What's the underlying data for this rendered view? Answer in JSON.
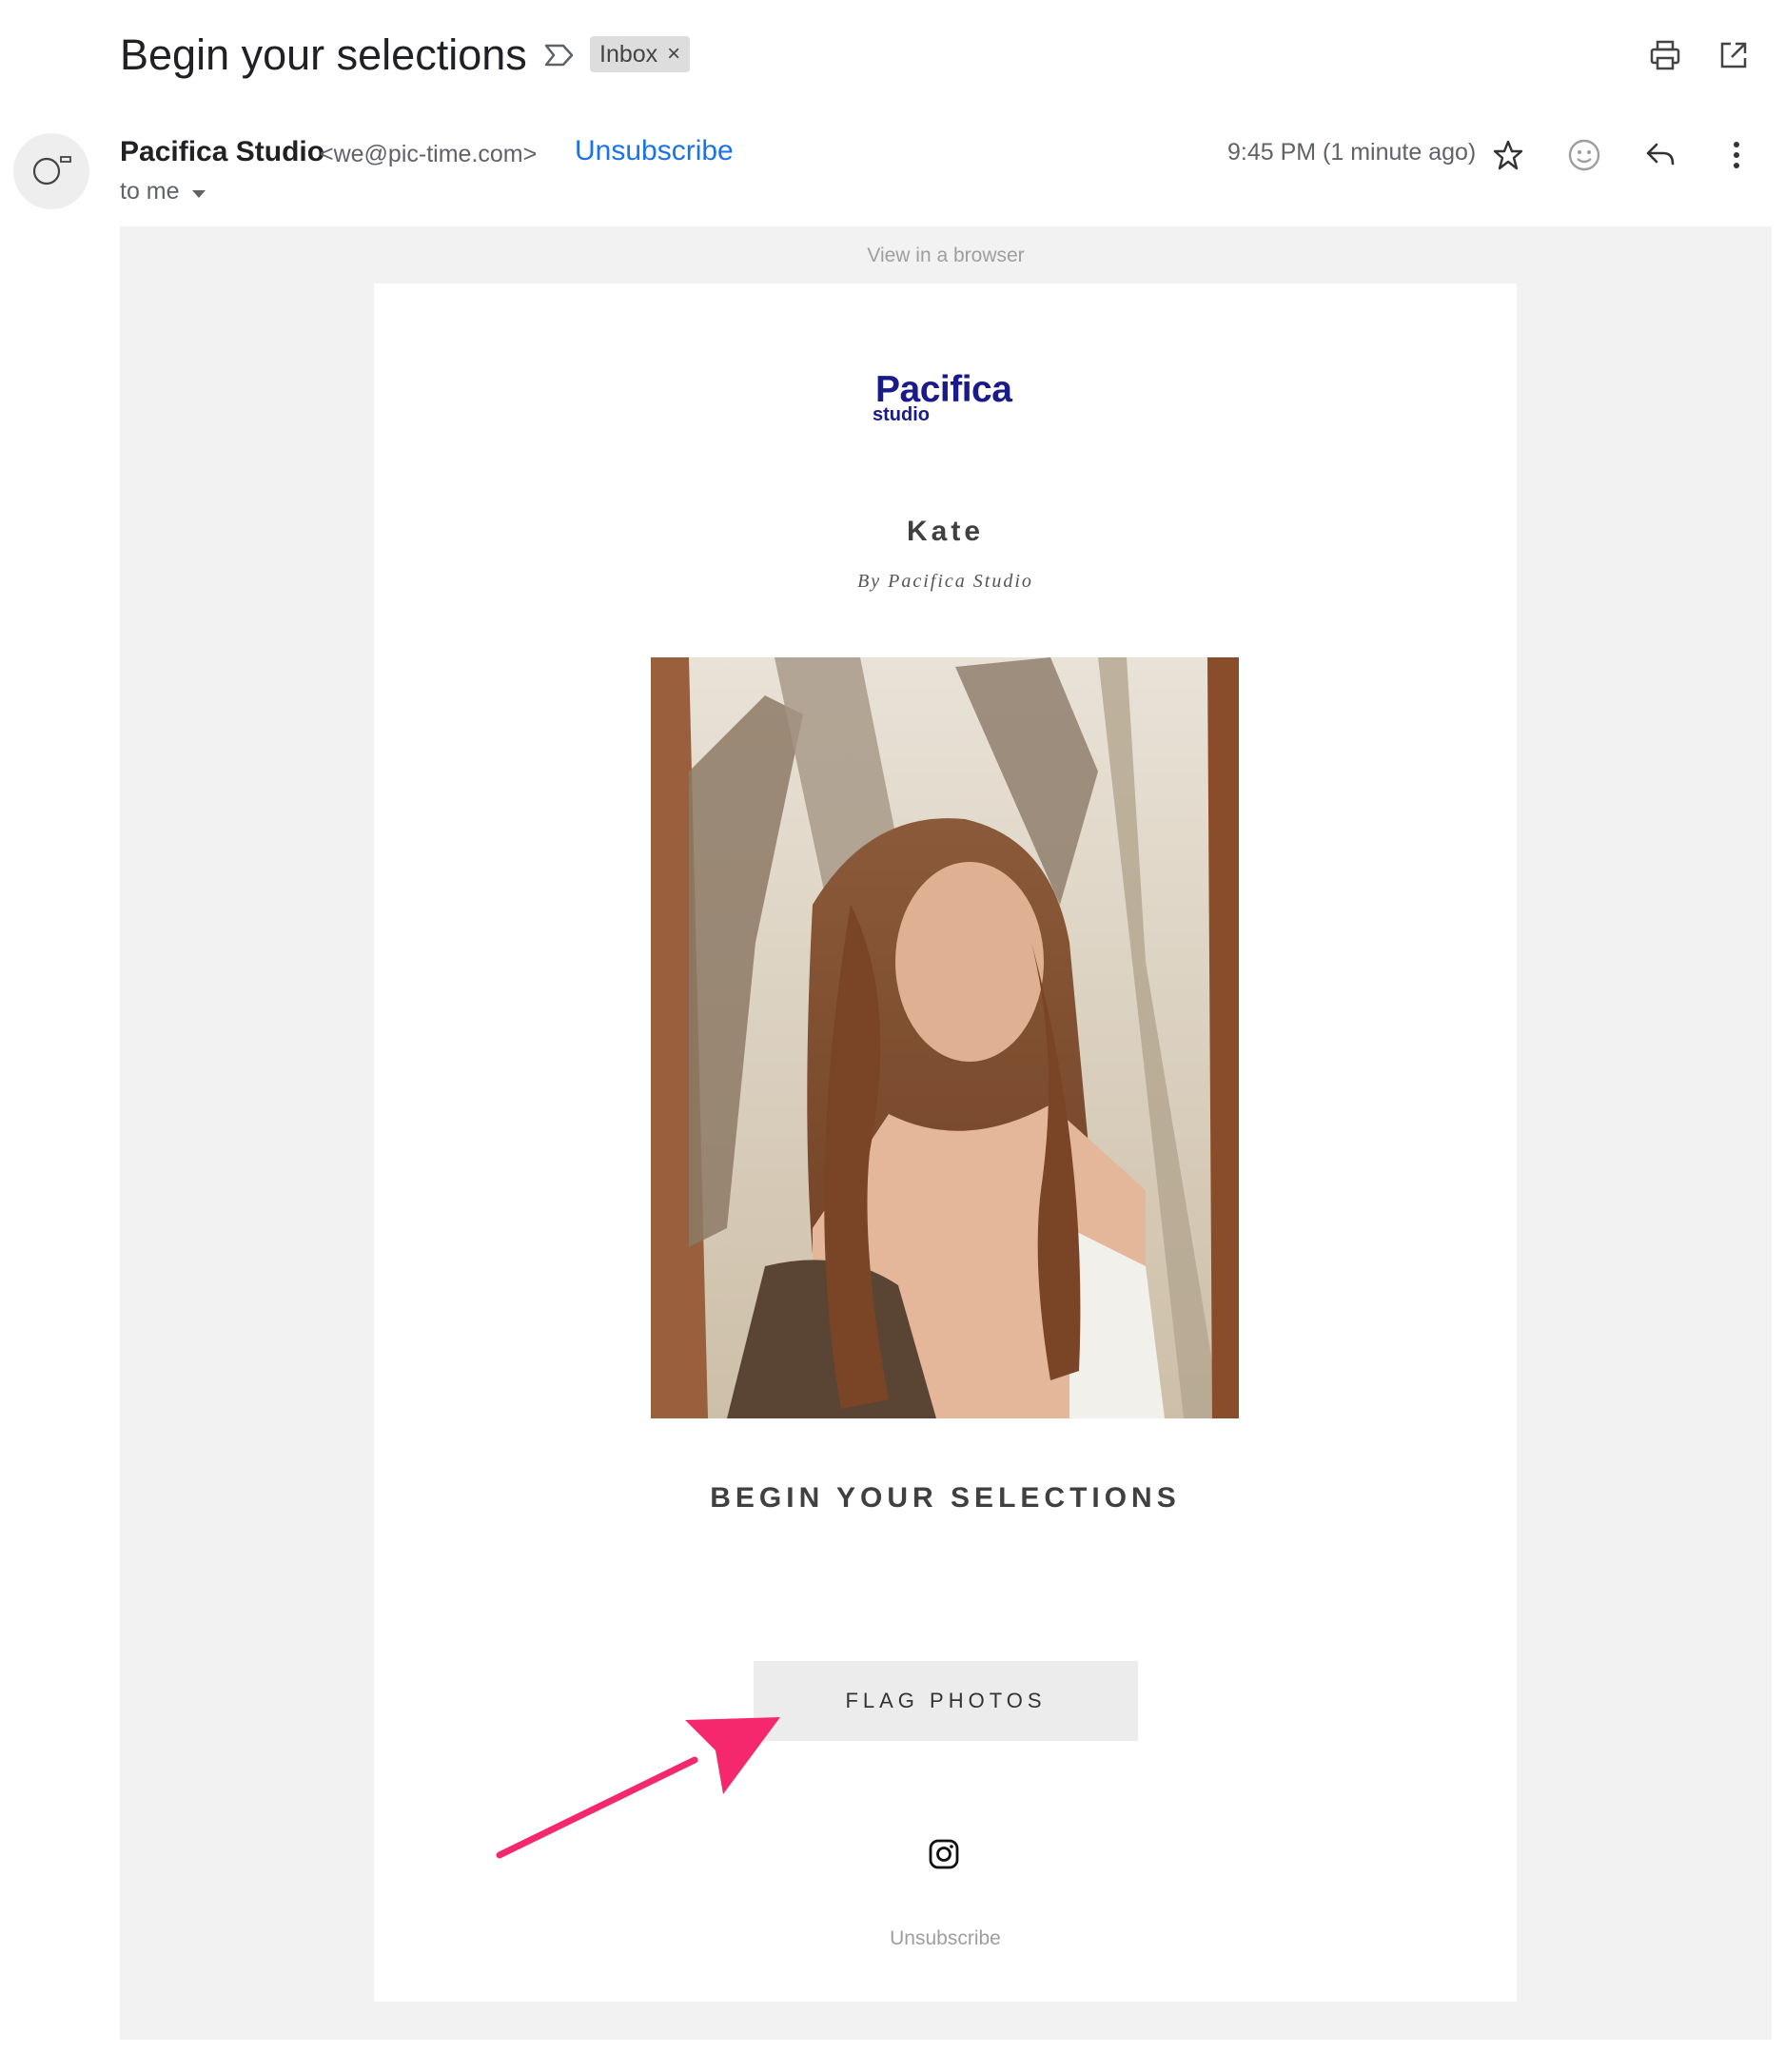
{
  "header": {
    "subject": "Begin your selections",
    "label_icon": "label-outline-icon",
    "chip_label": "Inbox",
    "chip_remove": "×",
    "print_icon": "printer-icon",
    "popout_icon": "open-in-new-window-icon"
  },
  "sender": {
    "avatar_icon": "default-avatar-icon",
    "name": "Pacifica Studio",
    "email": "<we@pic-time.com>",
    "unsubscribe": "Unsubscribe",
    "to": "to me",
    "time": "9:45 PM (1 minute ago)",
    "actions": [
      "star-icon",
      "emoji-reaction-icon",
      "reply-icon",
      "more-vertical-icon"
    ]
  },
  "email": {
    "view_in_browser": "View in a browser",
    "logo_main": "Pacifica",
    "logo_sub": "studio",
    "client_name": "Kate",
    "by_line": "By Pacifica Studio",
    "headline": "BEGIN YOUR SELECTIONS",
    "cta": "FLAG PHOTOS",
    "social_icon": "instagram-icon",
    "footer_unsubscribe": "Unsubscribe"
  },
  "colors": {
    "link_blue": "#1a73e8",
    "brand_navy": "#1a1a8c",
    "annotation_arrow": "#f5286e"
  }
}
